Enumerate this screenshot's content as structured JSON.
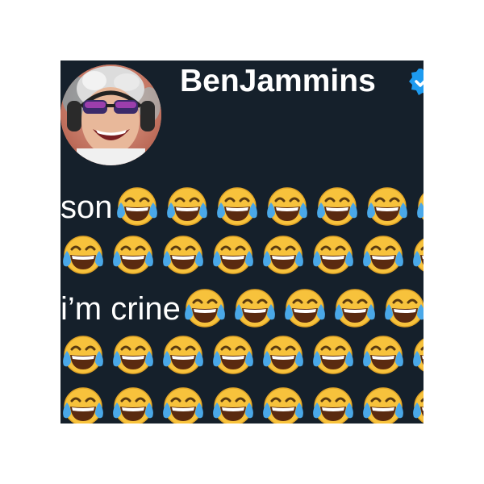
{
  "post": {
    "username": "BenJammins",
    "verified_icon": "verified-badge-icon",
    "avatar": "profile-photo-avatar",
    "lines": [
      {
        "text": "son",
        "emoji_count": 7
      },
      {
        "text": "",
        "emoji_count": 8
      },
      {
        "text": "i’m crine",
        "emoji_count": 5
      },
      {
        "text": "",
        "emoji_count": 8
      },
      {
        "text": "",
        "emoji_count": 8
      }
    ],
    "emoji_icon": "face-with-tears-of-joy-icon"
  },
  "colors": {
    "background": "#15202b",
    "text": "#ffffff",
    "verified": "#1d9bf0",
    "emoji_face": "#f7c23c",
    "tears": "#4aa8e8"
  }
}
